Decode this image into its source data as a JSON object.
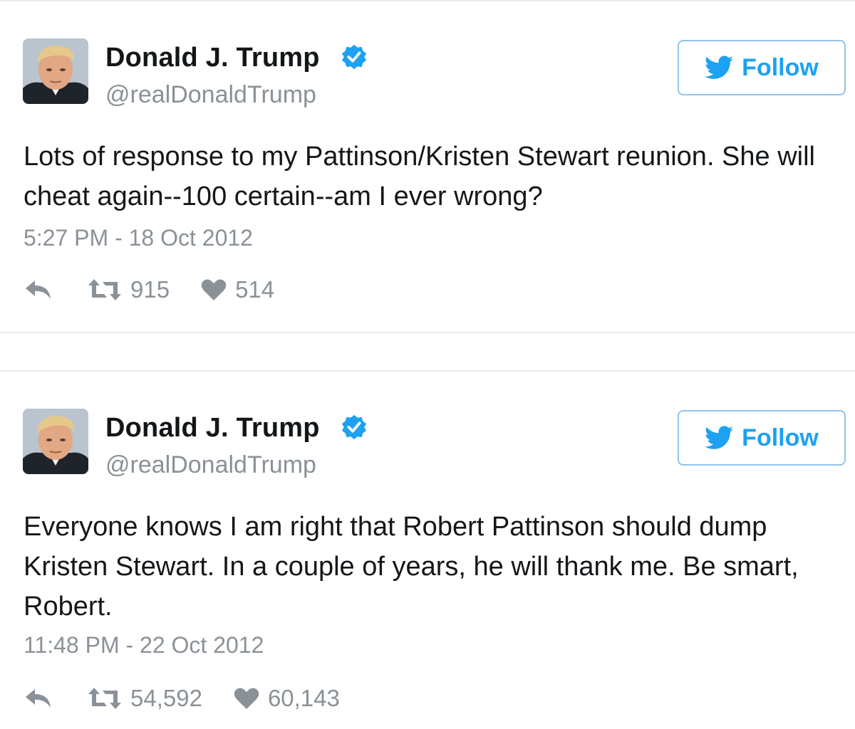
{
  "tweets": [
    {
      "name": "Donald J. Trump",
      "handle": "@realDonaldTrump",
      "follow_label": "Follow",
      "text": "Lots of response to my Pattinson/Kristen Stewart reunion. She will cheat again--100 certain--am I ever wrong?",
      "timestamp": "5:27 PM - 18 Oct 2012",
      "retweets": "915",
      "likes": "514"
    },
    {
      "name": "Donald J. Trump",
      "handle": "@realDonaldTrump",
      "follow_label": "Follow",
      "text": "Everyone knows I am right that Robert Pattinson should dump Kristen Stewart. In a couple of years, he will thank me. Be smart, Robert.",
      "timestamp": "11:48 PM - 22 Oct 2012",
      "retweets": "54,592",
      "likes": "60,143"
    }
  ],
  "colors": {
    "accent": "#1da1f2",
    "text": "#14171a",
    "muted": "#8a9198",
    "border": "#e6ecf0"
  },
  "icons": {
    "verified": "verified-badge-icon",
    "follow": "twitter-bird-icon",
    "reply": "reply-icon",
    "retweet": "retweet-icon",
    "like": "heart-icon"
  }
}
